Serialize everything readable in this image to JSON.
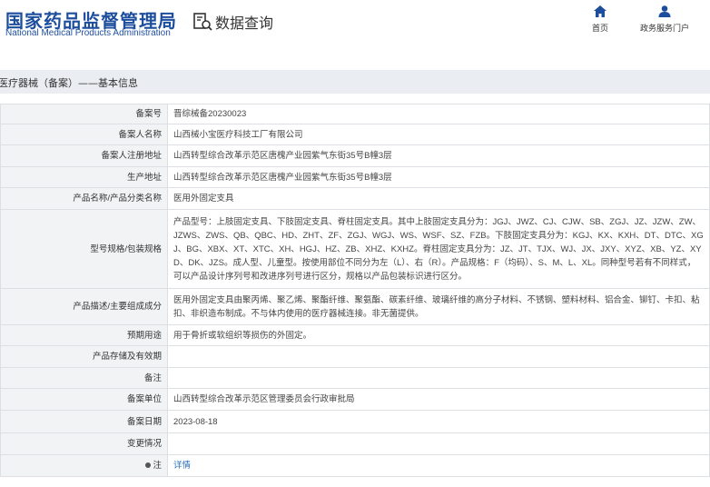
{
  "header": {
    "logo_cn": "国家药品监督管理局",
    "logo_en": "National Medical Products Administration",
    "query_label": "数据查询",
    "nav": [
      {
        "label": "首页",
        "icon": "home-icon"
      },
      {
        "label": "政务服务门户",
        "icon": "user-icon"
      }
    ]
  },
  "breadcrumb": "医疗器械（备案）——基本信息",
  "colors": {
    "brand": "#1d4e9e",
    "label_bg": "#f2f3f5",
    "crumb_bg": "#eaeef2",
    "link": "#2a6ebb"
  },
  "rows": [
    {
      "label": "备案号",
      "value": "晋综械备20230023"
    },
    {
      "label": "备案人名称",
      "value": "山西械小宝医疗科技工厂有限公司"
    },
    {
      "label": "备案人注册地址",
      "value": "山西转型综合改革示范区唐槐产业园紫气东街35号B幢3层"
    },
    {
      "label": "生产地址",
      "value": "山西转型综合改革示范区唐槐产业园紫气东街35号B幢3层"
    },
    {
      "label": "产品名称/产品分类名称",
      "value": "医用外固定支具"
    },
    {
      "label": "型号规格/包装规格",
      "value": "产品型号：上肢固定支具、下肢固定支具、脊柱固定支具。其中上肢固定支具分为：JGJ、JWZ、CJ、CJW、SB、ZGJ、JZ、JZW、ZW、JZWS、ZWS、QB、QBC、HD、ZHT、ZF、ZGJ、WGJ、WS、WSF、SZ、FZB。下肢固定支具分为：KGJ、KX、KXH、DT、DTC、XGJ、BG、XBX、XT、XTC、XH、HGJ、HZ、ZB、XHZ、KXHZ。脊柱固定支具分为：JZ、JT、TJX、WJ、JX、JXY、XYZ、XB、YZ、XYD、DK、JZS。成人型、儿童型。按使用部位不同分为左（L）、右（R）。产品规格：F（均码）、S、M、L、XL。同种型号若有不同样式，可以产品设计序列号和改进序列号进行区分，规格以产品包装标识进行区分。"
    },
    {
      "label": "产品描述/主要组成成分",
      "value": "医用外固定支具由聚丙烯、聚乙烯、聚酯纤维、聚氨酯、碳素纤维、玻璃纤维的高分子材料、不锈钢、塑料材料、铝合金、铆钉、卡扣、粘扣、非织造布制成。不与体内使用的医疗器械连接。非无菌提供。"
    },
    {
      "label": "预期用途",
      "value": "用于骨折或软组织等损伤的外固定。"
    },
    {
      "label": "产品存储及有效期",
      "value": ""
    },
    {
      "label": "备注",
      "value": ""
    },
    {
      "label": "备案单位",
      "value": "山西转型综合改革示范区管理委员会行政审批局"
    },
    {
      "label": "备案日期",
      "value": "2023-08-18"
    },
    {
      "label": "变更情况",
      "value": ""
    },
    {
      "label": "注",
      "value": "详情"
    }
  ]
}
